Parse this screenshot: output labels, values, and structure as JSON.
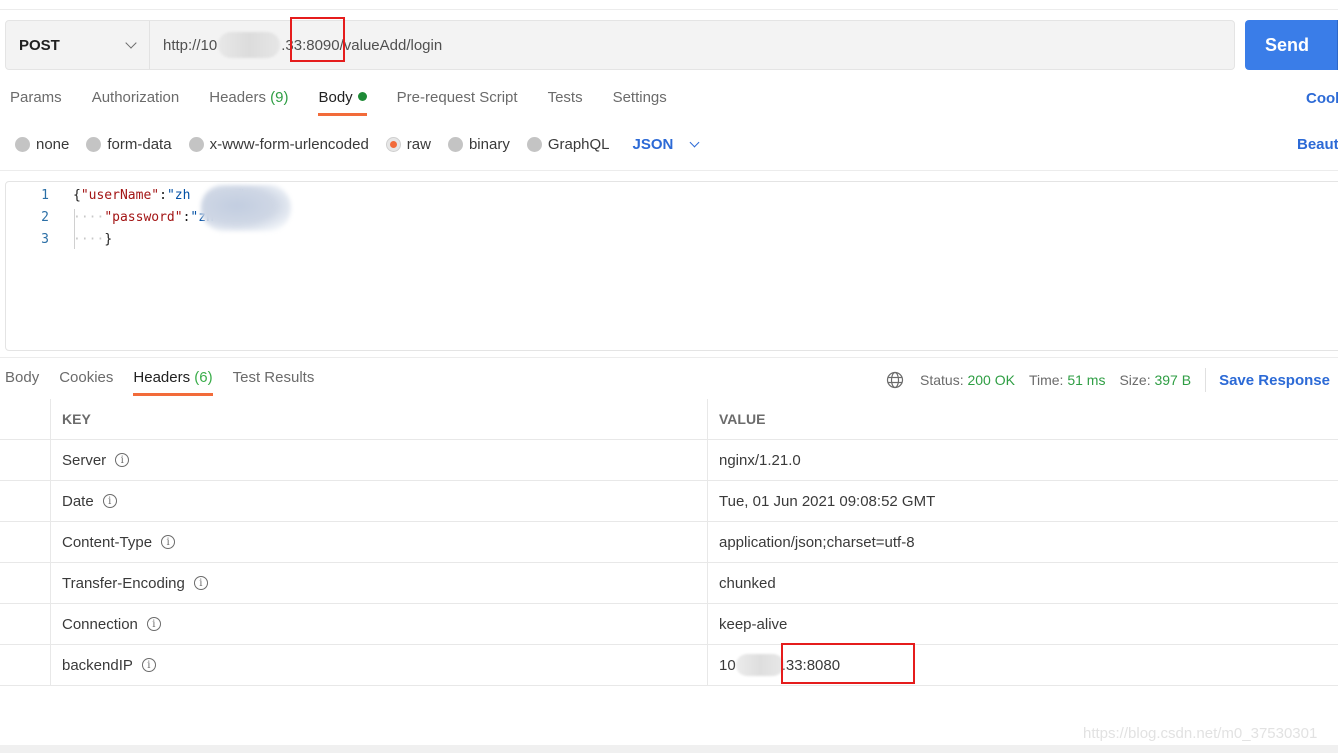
{
  "request": {
    "method": "POST",
    "url_prefix": "http://10",
    "url_suffix": ".33:8090/valueAdd/login",
    "send_label": "Send"
  },
  "request_tabs": [
    {
      "label": "Params"
    },
    {
      "label": "Authorization"
    },
    {
      "label": "Headers",
      "count": "(9)"
    },
    {
      "label": "Body",
      "active": true
    },
    {
      "label": "Pre-request Script"
    },
    {
      "label": "Tests"
    },
    {
      "label": "Settings"
    }
  ],
  "cookies_link": "Cool",
  "body_types": [
    {
      "label": "none"
    },
    {
      "label": "form-data"
    },
    {
      "label": "x-www-form-urlencoded"
    },
    {
      "label": "raw",
      "selected": true
    },
    {
      "label": "binary"
    },
    {
      "label": "GraphQL"
    }
  ],
  "language": "JSON",
  "beautify_link": "Beaut",
  "editor": {
    "line_numbers": [
      "1",
      "2",
      "3"
    ],
    "line1_key": "\"userName\"",
    "line1_value": "\"zh    ng\"",
    "line2_key": "\"password\"",
    "line2_value": "\"zh",
    "open_brace": "{",
    "close_brace": "}",
    "colon": ":",
    "indent": "····"
  },
  "response_tabs": [
    {
      "label": "Body"
    },
    {
      "label": "Cookies"
    },
    {
      "label": "Headers",
      "count": "(6)",
      "active": true
    },
    {
      "label": "Test Results"
    }
  ],
  "response_meta": {
    "status_label": "Status:",
    "status_value": "200 OK",
    "time_label": "Time:",
    "time_value": "51 ms",
    "size_label": "Size:",
    "size_value": "397 B",
    "save_label": "Save Response"
  },
  "headers_table": {
    "columns": [
      "KEY",
      "VALUE"
    ],
    "rows": [
      {
        "key": "Server",
        "value": "nginx/1.21.0"
      },
      {
        "key": "Date",
        "value": "Tue, 01 Jun 2021 09:08:52 GMT"
      },
      {
        "key": "Content-Type",
        "value": "application/json;charset=utf-8"
      },
      {
        "key": "Transfer-Encoding",
        "value": "chunked"
      },
      {
        "key": "Connection",
        "value": "keep-alive"
      },
      {
        "key": "backendIP",
        "value_prefix": "10",
        "value_suffix": ".33:8080"
      }
    ]
  },
  "icons": {
    "info": "i",
    "globe": "globe-icon"
  },
  "watermark": "https://blog.csdn.net/m0_37530301",
  "colors": {
    "accent_orange": "#f26b3a",
    "send_blue": "#3a7de8",
    "link_blue": "#2c6ad6",
    "status_green": "#2f9e44",
    "annotation_red": "#e51c1c"
  }
}
